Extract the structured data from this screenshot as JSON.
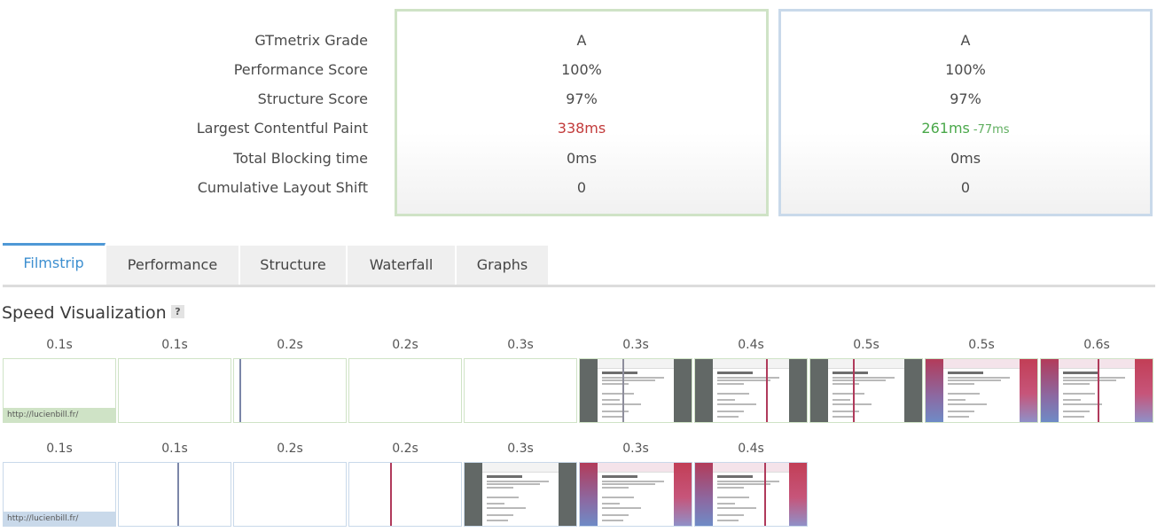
{
  "metrics": {
    "labels": [
      "GTmetrix Grade",
      "Performance Score",
      "Structure Score",
      "Largest Contentful Paint",
      "Total Blocking time",
      "Cumulative Layout Shift"
    ],
    "report1": [
      "A",
      "100%",
      "97%",
      "338ms",
      "0ms",
      "0"
    ],
    "report2": [
      "A",
      "100%",
      "97%",
      "261ms",
      "0ms",
      "0"
    ],
    "report2_lcp_delta": "-77ms"
  },
  "tabs": [
    "Filmstrip",
    "Performance",
    "Structure",
    "Waterfall",
    "Graphs"
  ],
  "active_tab": "Filmstrip",
  "speed": {
    "title": "Speed Visualization",
    "help": "?",
    "url": "http://lucienbill.fr/",
    "row1_times": [
      "0.1s",
      "0.1s",
      "0.2s",
      "0.2s",
      "0.3s",
      "0.3s",
      "0.4s",
      "0.5s",
      "0.5s",
      "0.6s"
    ],
    "row2_times": [
      "0.1s",
      "0.1s",
      "0.2s",
      "0.2s",
      "0.3s",
      "0.3s",
      "0.4s"
    ]
  },
  "colors": {
    "report1_border": "#cfe3c6",
    "report2_border": "#c9d9ea",
    "worse": "#c23b3b",
    "better": "#4aa84a",
    "active_tab": "#3d8fd0"
  }
}
